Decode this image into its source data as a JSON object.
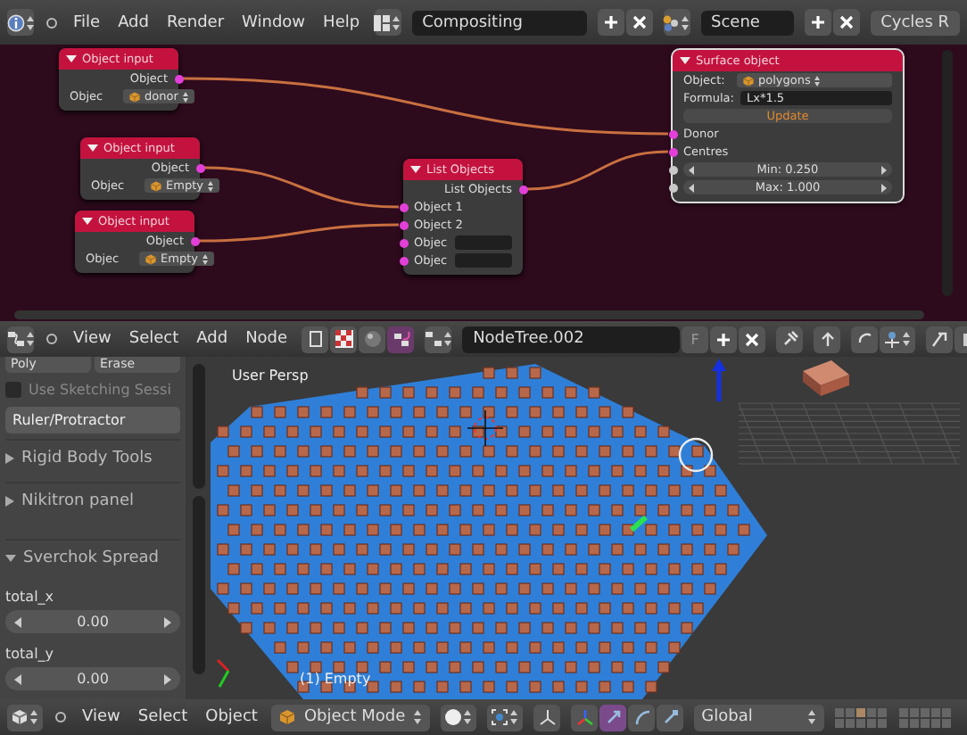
{
  "top_header": {
    "menus": [
      "File",
      "Add",
      "Render",
      "Window",
      "Help"
    ],
    "screen_layout": "Compositing",
    "scene": "Scene",
    "render_engine": "Cycles R"
  },
  "node_editor": {
    "nodes": [
      {
        "title": "Object input",
        "rows": [
          {
            "kind": "output",
            "label": "Object"
          },
          {
            "kind": "prop",
            "label": "Objec",
            "value": "donor"
          }
        ]
      },
      {
        "title": "Object input",
        "rows": [
          {
            "kind": "output",
            "label": "Object"
          },
          {
            "kind": "prop",
            "label": "Objec",
            "value": "Empty"
          }
        ]
      },
      {
        "title": "Object input",
        "rows": [
          {
            "kind": "output",
            "label": "Object"
          },
          {
            "kind": "prop",
            "label": "Objec",
            "value": "Empty"
          }
        ]
      },
      {
        "title": "List Objects",
        "rows": [
          {
            "kind": "output",
            "label": "List Objects"
          },
          {
            "kind": "input",
            "label": "Object 1"
          },
          {
            "kind": "input",
            "label": "Object 2"
          },
          {
            "kind": "input_field",
            "label": "Objec"
          },
          {
            "kind": "input_field",
            "label": "Objec"
          }
        ]
      },
      {
        "title": "Surface object",
        "rows": [
          {
            "kind": "prop",
            "label": "Object:",
            "value": "polygons"
          },
          {
            "kind": "text",
            "label": "Formula:",
            "value": "Lx*1.5"
          },
          {
            "kind": "button",
            "label": "Update"
          },
          {
            "kind": "input",
            "label": "Donor"
          },
          {
            "kind": "input",
            "label": "Centres"
          },
          {
            "kind": "number",
            "label": "Min: 0.250"
          },
          {
            "kind": "number",
            "label": "Max: 1.000"
          }
        ]
      }
    ]
  },
  "node_header": {
    "menus": [
      "View",
      "Select",
      "Add",
      "Node"
    ],
    "node_tree": "NodeTree.002",
    "fake_user": "F"
  },
  "tool_shelf": {
    "cut_buttons": [
      "Poly",
      "Erase"
    ],
    "sketch_checkbox": {
      "label": "Use Sketching Sessi",
      "checked": false,
      "disabled": true
    },
    "ruler_button": "Ruler/Protractor",
    "panels": [
      {
        "title": "Rigid Body Tools",
        "expanded": false
      },
      {
        "title": "Nikitron panel",
        "expanded": false
      },
      {
        "title": "Sverchok Spread",
        "expanded": true,
        "fields": [
          {
            "label": "total_x",
            "value": "0.00"
          },
          {
            "label": "total_y",
            "value": "0.00"
          }
        ]
      }
    ]
  },
  "viewport": {
    "view_label": "User Persp",
    "object_label": "(1) Empty"
  },
  "view3d_header": {
    "menus": [
      "View",
      "Select",
      "Object"
    ],
    "mode": "Object Mode",
    "orientation": "Global"
  }
}
